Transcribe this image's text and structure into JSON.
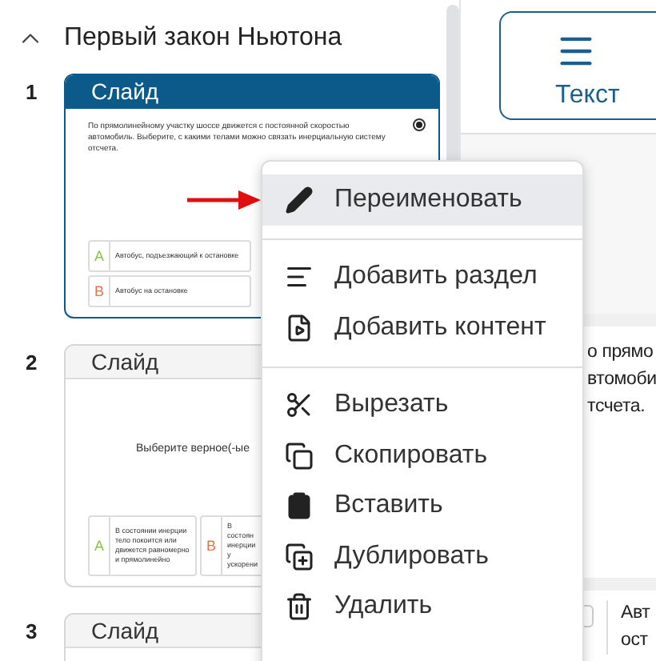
{
  "section": {
    "title": "Первый закон Ньютона",
    "expanded": true
  },
  "slides": [
    {
      "number": "1",
      "header": "Слайд",
      "selected": true,
      "question": "По прямолинейному участку шоссе движется с постоянной скоростью автомобиль. Выберите, с какими телами можно связать инерциальную систему отсчета.",
      "answers": [
        {
          "letter": "A",
          "text": "Автобус, подъезжающий к остановке",
          "color": "#8bc34a"
        },
        {
          "letter": "B",
          "text": "Автобус на остановке",
          "color": "#e5734a"
        }
      ]
    },
    {
      "number": "2",
      "header": "Слайд",
      "selected": false,
      "question": "Выберите верное(-ые",
      "answers": [
        {
          "letter": "A",
          "text": "В состоянии инерции тело покоится или движется равномерно и прямолинейно",
          "color": "#8bc34a"
        },
        {
          "letter": "B",
          "text": "В состоян инерции у ускорени",
          "color": "#e5734a"
        }
      ]
    },
    {
      "number": "3",
      "header": "Слайд",
      "selected": false
    }
  ],
  "toolbar": {
    "text_button": "Текст"
  },
  "canvas": {
    "checkbox_checked": false,
    "question_lines": [
      "о прямо",
      "втомоби",
      "тсчета."
    ],
    "answer_lines": [
      "Авт",
      "ост"
    ]
  },
  "context_menu": {
    "groups": [
      [
        {
          "label": "Переименовать",
          "selected": true
        }
      ],
      [
        {
          "label": "Добавить раздел",
          "selected": false
        },
        {
          "label": "Добавить контент",
          "selected": false
        }
      ],
      [
        {
          "label": "Вырезать",
          "selected": false
        },
        {
          "label": "Скопировать",
          "selected": false
        },
        {
          "label": "Вставить",
          "selected": false
        },
        {
          "label": "Дублировать",
          "selected": false
        },
        {
          "label": "Удалить",
          "selected": false
        }
      ]
    ]
  }
}
